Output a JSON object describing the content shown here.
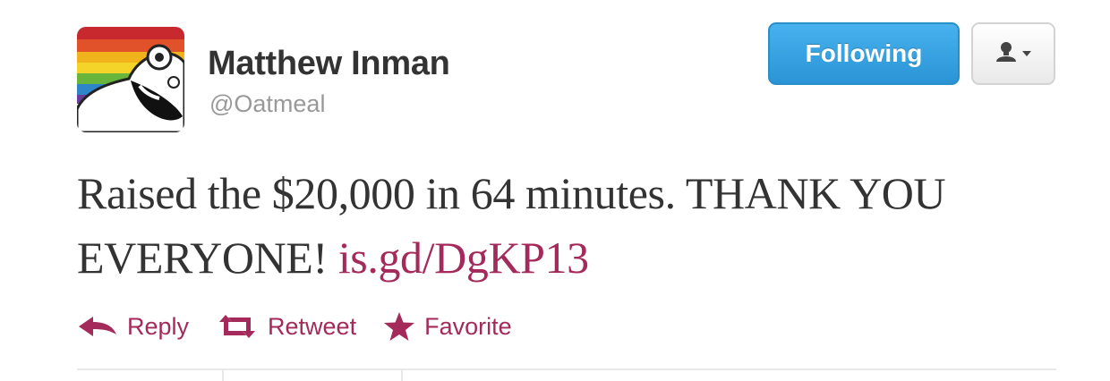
{
  "user": {
    "display_name": "Matthew Inman",
    "handle": "@Oatmeal",
    "avatar_icon": "oatmeal-comic-avatar"
  },
  "buttons": {
    "follow_label": "Following",
    "user_menu_icon": "person-dropdown-icon"
  },
  "tweet": {
    "text": "Raised the $20,000 in 64 minutes. THANK YOU EVERYONE!",
    "link": "is.gd/DgKP13"
  },
  "actions": {
    "reply_label": "Reply",
    "reply_icon": "reply-arrow-icon",
    "retweet_label": "Retweet",
    "retweet_icon": "retweet-icon",
    "favorite_label": "Favorite",
    "favorite_icon": "star-icon"
  },
  "colors": {
    "action_accent": "#a32a5a",
    "follow_button": "#2a94d6",
    "name_text": "#333333",
    "handle_text": "#999999"
  }
}
